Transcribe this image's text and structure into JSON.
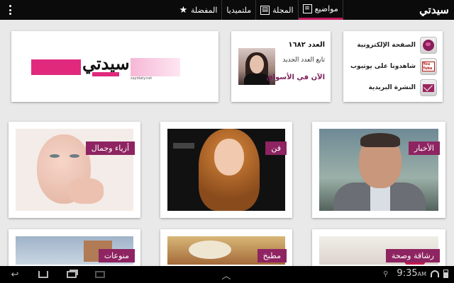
{
  "topbar": {
    "logo": "سيدتي",
    "tabs": [
      {
        "label": "مواضيع",
        "icon": "document-icon"
      },
      {
        "label": "المجلة",
        "icon": "magazine-icon"
      },
      {
        "label": "ملتميديا",
        "icon": "multimedia-icon"
      },
      {
        "label": "المفضلة",
        "icon": "star-icon"
      }
    ],
    "active_tab": "مواضيع",
    "accent": "#c2185b"
  },
  "brand_banner": {
    "logo_text": "سيدتي",
    "url": "sayidaty.net"
  },
  "issue": {
    "number": "العدد ١٦٨٢",
    "follow": "تابع العدد الجديد",
    "now": "الآن في الأسواق"
  },
  "links": [
    {
      "label": "الصفحة الإلكترونية",
      "icon": "globe-icon"
    },
    {
      "label": "شاهدونا على يوتيوب",
      "icon": "youtube-icon",
      "icon_text": "You Tube"
    },
    {
      "label": "النشرة البريدية",
      "icon": "mail-icon"
    }
  ],
  "categories": [
    {
      "label": "الأخبار"
    },
    {
      "label": "فن"
    },
    {
      "label": "أزياء وجمال"
    },
    {
      "label": "رشاقة وصحة"
    },
    {
      "label": "مطبخ"
    },
    {
      "label": "منوعات"
    }
  ],
  "status_bar": {
    "time": "9:35",
    "time_suffix": "AM"
  },
  "colors": {
    "label_bg": "#8e2461",
    "brand_pink": "#e0297d"
  }
}
